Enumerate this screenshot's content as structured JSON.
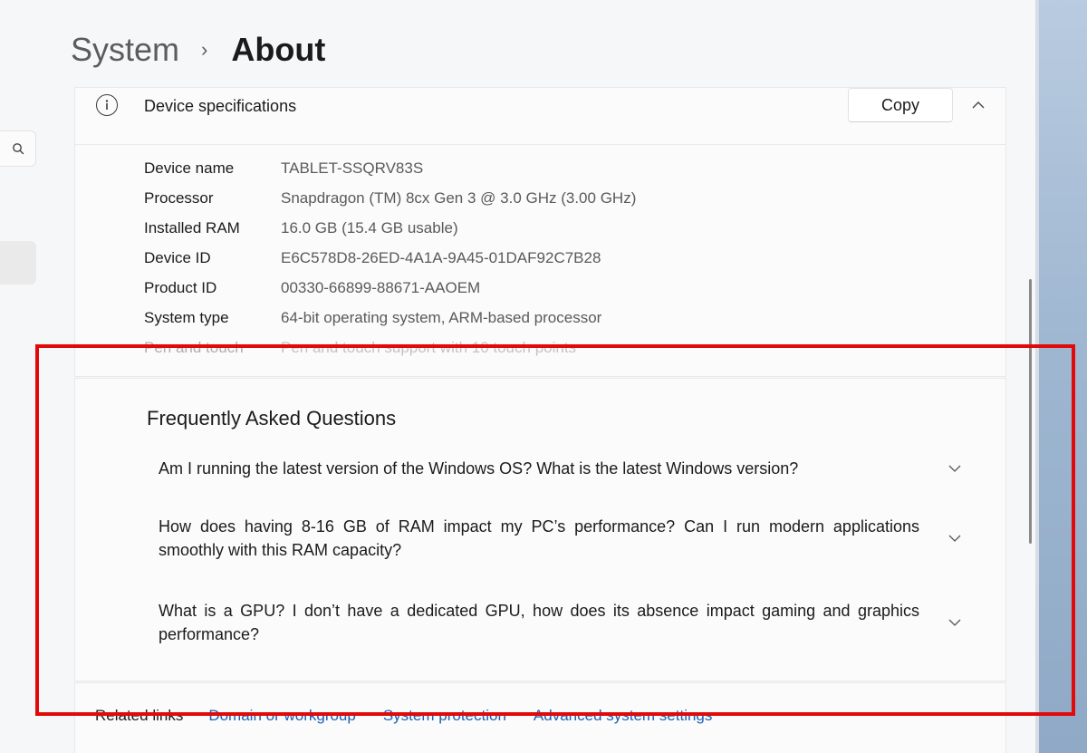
{
  "breadcrumb": {
    "parent": "System",
    "separator": "›",
    "current": "About"
  },
  "specs": {
    "title": "Device specifications",
    "copy_label": "Copy",
    "rows": [
      {
        "label": "Device name",
        "value": "TABLET-SSQRV83S"
      },
      {
        "label": "Processor",
        "value": "Snapdragon (TM) 8cx Gen 3 @ 3.0 GHz (3.00 GHz)"
      },
      {
        "label": "Installed RAM",
        "value": "16.0 GB (15.4 GB usable)"
      },
      {
        "label": "Device ID",
        "value": "E6C578D8-26ED-4A1A-9A45-01DAF92C7B28"
      },
      {
        "label": "Product ID",
        "value": "00330-66899-88671-AAOEM"
      },
      {
        "label": "System type",
        "value": "64-bit operating system, ARM-based processor"
      },
      {
        "label": "Pen and touch",
        "value": "Pen and touch support with 10 touch points"
      }
    ]
  },
  "faq": {
    "title": "Frequently Asked Questions",
    "items": [
      {
        "question": "Am I running the latest version of the Windows OS? What is the latest Windows version?"
      },
      {
        "question": "How does having 8-16 GB of RAM impact my PC’s performance? Can I run modern applications smoothly with this RAM capacity?"
      },
      {
        "question": "What is a GPU? I don’t have a dedicated GPU, how does its absence impact gaming and graphics performance?"
      }
    ]
  },
  "related": {
    "label": "Related links",
    "links": [
      "Domain or workgroup",
      "System protection",
      "Advanced system settings"
    ]
  },
  "colors": {
    "highlight": "#e10a0a",
    "link": "#1a5fb4"
  }
}
